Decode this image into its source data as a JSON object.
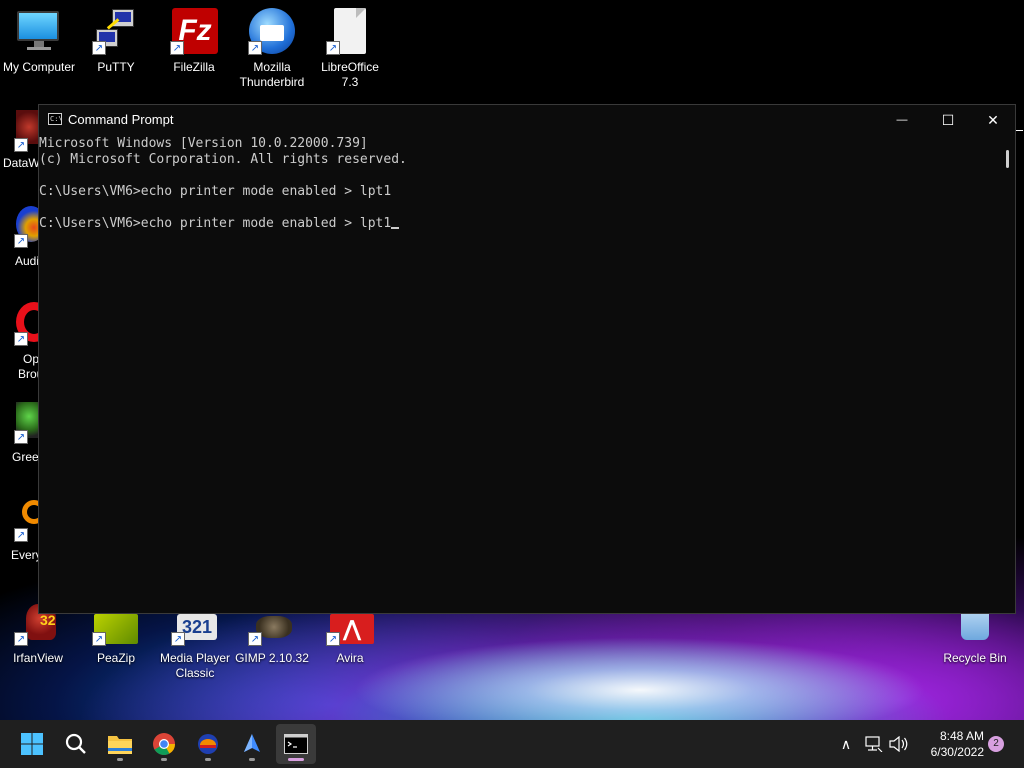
{
  "desktop": {
    "top_icons": [
      {
        "label": "My Computer",
        "icon": "computer-icon"
      },
      {
        "label": "PuTTY",
        "icon": "putty-icon"
      },
      {
        "label": "FileZilla",
        "icon": "filezilla-icon"
      },
      {
        "label": "Mozilla Thunderbird",
        "icon": "thunderbird-icon"
      },
      {
        "label": "LibreOffice 7.3",
        "icon": "libreoffice-icon"
      }
    ],
    "left_icons": [
      {
        "label": "DataW",
        "icon": "datawrangler-icon"
      },
      {
        "label": "Audi",
        "icon": "audio-app-icon"
      },
      {
        "label": "Op",
        "label2": "Brou",
        "icon": "opera-icon"
      },
      {
        "label": "Greer",
        "icon": "greenshot-icon"
      },
      {
        "label": "Every",
        "icon": "everything-icon"
      }
    ],
    "bottom_icons": [
      {
        "label": "IrfanView",
        "icon": "irfanview-icon"
      },
      {
        "label": "PeaZip",
        "icon": "peazip-icon"
      },
      {
        "label": "Media Player Classic",
        "icon": "media-player-classic-icon"
      },
      {
        "label": "GIMP 2.10.32",
        "icon": "gimp-icon"
      },
      {
        "label": "Avira",
        "icon": "avira-icon"
      }
    ],
    "recycle_bin": {
      "label": "Recycle Bin",
      "icon": "recycle-bin-icon"
    }
  },
  "cmd_window": {
    "title": "Command Prompt",
    "icon_text": "C:\\",
    "minimize_glyph": "—",
    "maximize_glyph": "☐",
    "close_glyph": "✕",
    "lines": [
      "Microsoft Windows [Version 10.0.22000.739]",
      "(c) Microsoft Corporation. All rights reserved.",
      "",
      "C:\\Users\\VM6>echo printer mode enabled > lpt1",
      "",
      "C:\\Users\\VM6>echo printer mode enabled > lpt1"
    ]
  },
  "taskbar": {
    "pinned": [
      {
        "name": "start-button",
        "icon": "windows-logo-icon"
      },
      {
        "name": "search-button",
        "icon": "search-icon"
      },
      {
        "name": "file-explorer-button",
        "icon": "folder-icon"
      },
      {
        "name": "chrome-button",
        "icon": "chrome-icon"
      },
      {
        "name": "app-button",
        "icon": "app-icon"
      },
      {
        "name": "app2-button",
        "icon": "app2-icon"
      },
      {
        "name": "command-prompt-button",
        "icon": "terminal-icon"
      }
    ],
    "time": "8:48 AM",
    "date": "6/30/2022",
    "notification_count": "2",
    "chevron_glyph": "∧"
  }
}
